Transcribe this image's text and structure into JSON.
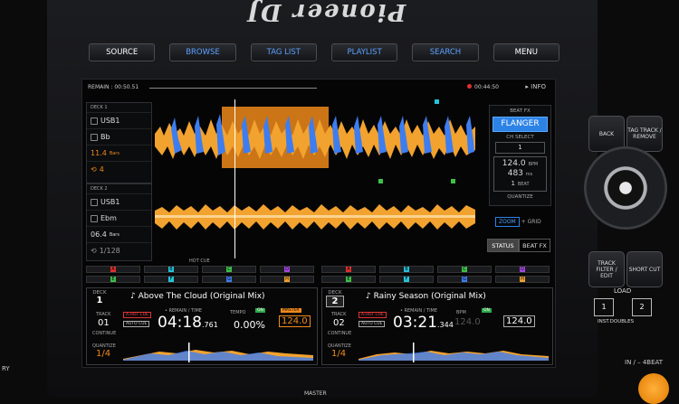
{
  "brand": "Pioneer DJ",
  "top_buttons": [
    "SOURCE",
    "BROWSE",
    "TAG LIST",
    "PLAYLIST",
    "SEARCH",
    "MENU"
  ],
  "header": {
    "remain": "REMAIN : 00:50.51",
    "clock": "00:44:50",
    "info": "INFO"
  },
  "deck1_panel": {
    "label": "DECK 1",
    "source": "USB1",
    "key": "Bb",
    "bars": "11.4",
    "bars_unit": "Bars",
    "loop": "4"
  },
  "deck2_panel": {
    "label": "DECK 2",
    "source": "USB1",
    "key": "Ebm",
    "bars": "06.4",
    "bars_unit": "Bars",
    "loop": "1/128"
  },
  "fx_panel": {
    "title": "BEAT FX",
    "effect": "FLANGER",
    "ch_select_label": "CH SELECT",
    "ch_value": "1",
    "bpm": "124.0",
    "bpm_unit": "BPM",
    "ms": "483",
    "ms_unit": "ms",
    "beat": "1",
    "beat_unit": "BEAT",
    "quantize": "QUANTIZE"
  },
  "zoom": {
    "zoom": "ZOOM",
    "grid": "GRID"
  },
  "status_tabs": {
    "status": "STATUS",
    "beatfx": "BEAT FX"
  },
  "hot_cue_label": "HOT CUE",
  "hot_cues_left": [
    "A",
    "B",
    "C",
    "D",
    "E",
    "F",
    "G",
    "H"
  ],
  "hot_cues_right": [
    "A",
    "B",
    "C",
    "D",
    "E",
    "F",
    "G",
    "H"
  ],
  "deck1": {
    "deck_label": "DECK",
    "deck_num": "1",
    "title": "Above The Cloud (Original Mix)",
    "track_label": "TRACK",
    "track": "01",
    "continue": "CONTINUE",
    "quantize": "QUANTIZE",
    "quantize_val": "1/4",
    "hotcue_tag": "A.HOT CUE",
    "autocue_tag": "AUTO CUE",
    "remain_label": "REMAIN",
    "time_label": "TIME",
    "time": "04:18",
    "time_ms": ".761",
    "tempo_label": "TEMPO",
    "tempo": "0.00%",
    "on_badge": "ON",
    "master": "MASTER",
    "bpm": "124.0"
  },
  "deck2": {
    "deck_label": "DECK",
    "deck_num": "2",
    "title": "Rainy Season (Original Mix)",
    "track_label": "TRACK",
    "track": "02",
    "continue": "CONTINUE",
    "quantize": "QUANTIZE",
    "quantize_val": "1/4",
    "hotcue_tag": "A.HOT CUE",
    "autocue_tag": "AUTO CUE",
    "remain_label": "REMAIN",
    "time_label": "TIME",
    "time": "03:21",
    "time_ms": ".344",
    "bpm_label": "BPM",
    "bpm_ghost": "124.0",
    "on_badge": "ON",
    "bpm": "124.0"
  },
  "side": {
    "back": "BACK",
    "tag_track": "TAG TRACK / REMOVE",
    "track_filter": "TRACK FILTER / EDIT",
    "short_cut": "SHORT CUT",
    "load": "LOAD",
    "load1": "1",
    "load2": "2",
    "inst": "INST.DOUBLES",
    "in4beat": "IN / – 4BEAT",
    "master_bottom": "MASTER",
    "left_edge": "RY"
  },
  "colors": {
    "wave_orange": "#f2a22e",
    "wave_blue": "#3d7df0",
    "loop_region": "#f08a1a",
    "accent_blue": "#2d82e6"
  }
}
